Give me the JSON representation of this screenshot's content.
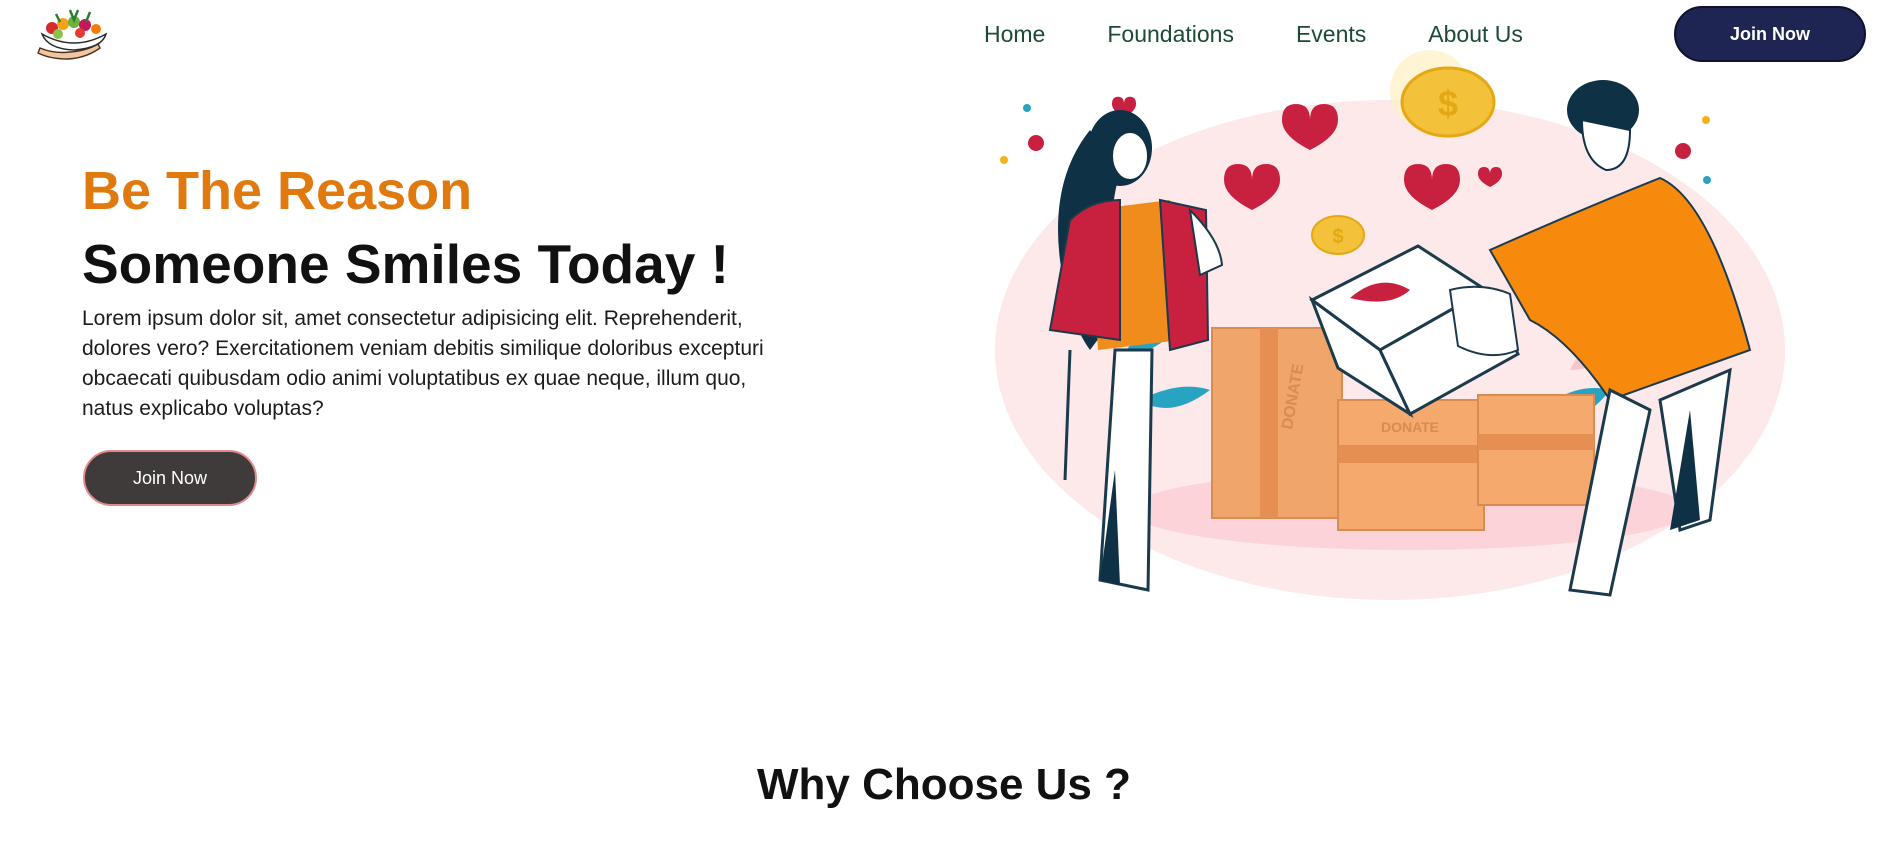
{
  "header": {
    "logo_icon": "food-basket-hand-icon",
    "nav": [
      "Home",
      "Foundations",
      "Events",
      "About Us"
    ],
    "join_button": "Join Now",
    "nav_color": "#1c4a33",
    "join_button_color": "#1f2552"
  },
  "hero": {
    "title_line1": "Be The Reason",
    "title_line2": "Someone Smiles Today !",
    "body": "Lorem ipsum dolor sit, amet consectetur adipisicing elit. Reprehenderit, dolores vero? Exercitationem veniam debitis similique doloribus excepturi obcaecati quibusdam odio animi voluptatibus ex quae neque, illum quo, natus explicabo voluptas?",
    "join_button": "Join Now",
    "accent_color": "#e07a0f",
    "illustration": {
      "icon": "donation-illustration",
      "box_label_1": "DONATE",
      "box_label_2": "DONATE"
    }
  },
  "section": {
    "why_title": "Why Choose Us ?"
  }
}
